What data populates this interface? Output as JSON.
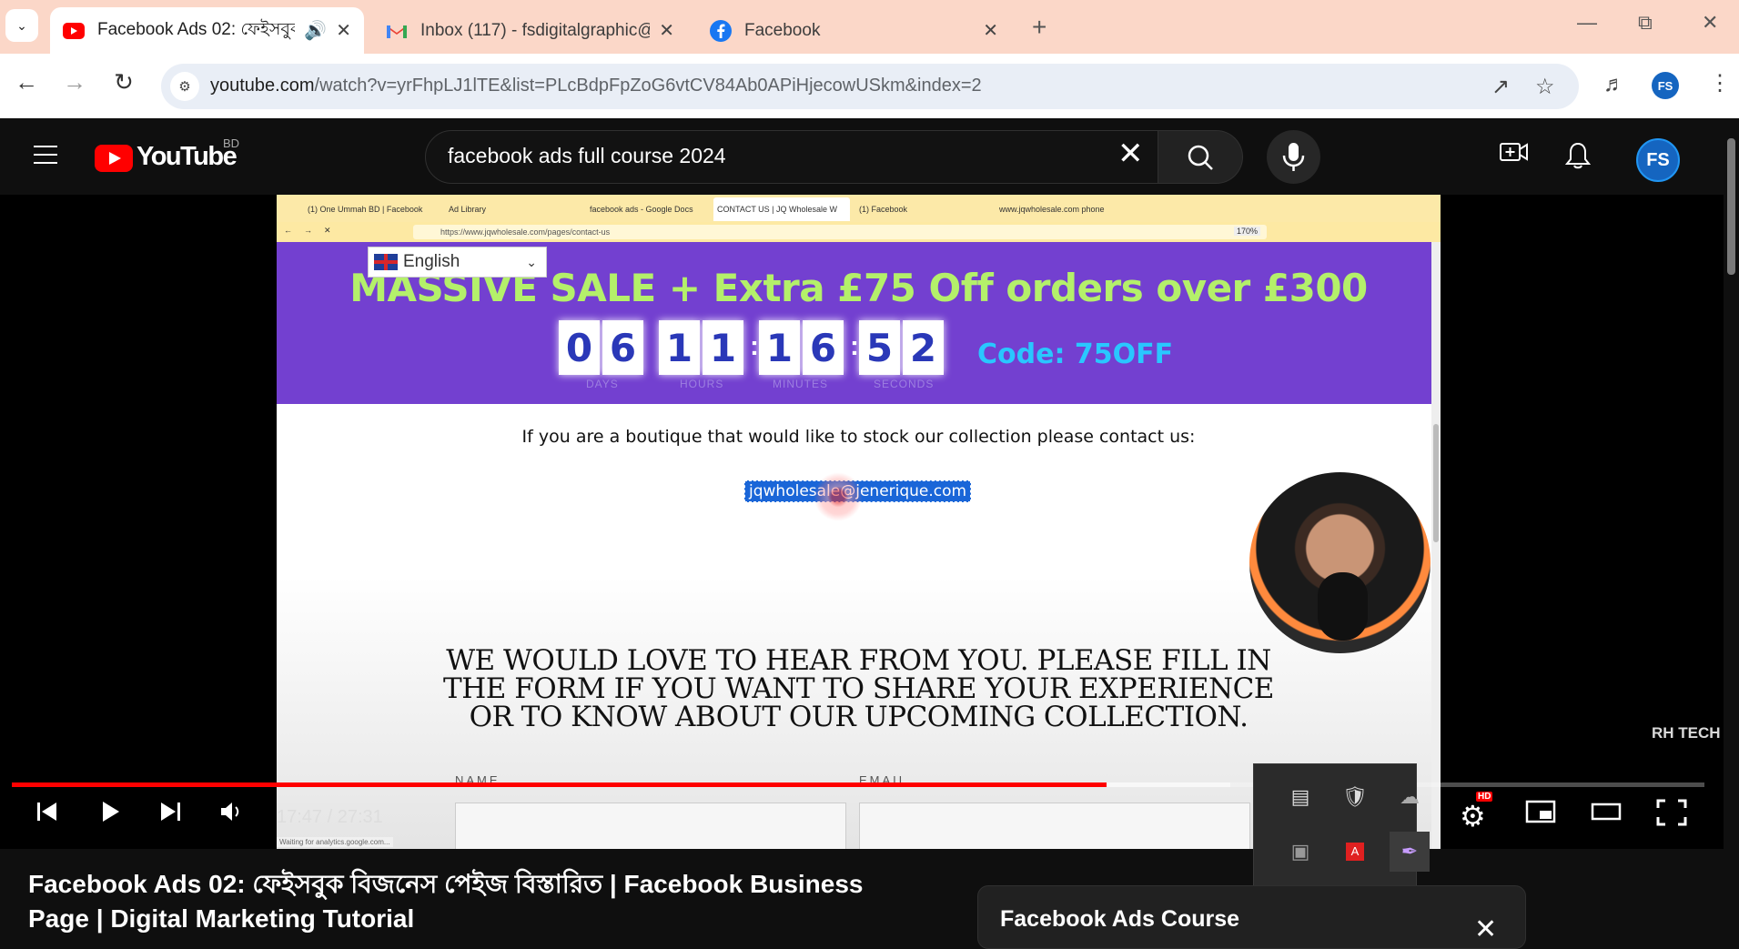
{
  "browser": {
    "tabs": [
      {
        "title": "Facebook Ads 02: ফেইসবুক",
        "icon": "youtube-icon",
        "active": true,
        "audio": true
      },
      {
        "title": "Inbox (117) - fsdigitalgraphic@g",
        "icon": "gmail-icon",
        "active": false
      },
      {
        "title": "Facebook",
        "icon": "facebook-icon",
        "active": false
      }
    ],
    "url_domain": "youtube.com",
    "url_rest": "/watch?v=yrFhpLJ1lTE&list=PLcBdpFpZoG6vtCV84Ab0APiHjecowUSkm&index=2",
    "profile_initials": "FS"
  },
  "youtube": {
    "logo_text": "YouTube",
    "country": "BD",
    "search_query": "facebook ads full course 2024",
    "avatar_initials": "FS"
  },
  "video": {
    "inner_tabs": [
      "(1) One Ummah BD | Facebook",
      "Ad Library",
      "facebook ads - Google Docs",
      "CONTACT US | JQ Wholesale W",
      "(1) Facebook",
      "www.jqwholesale.com phone"
    ],
    "inner_url": "https://www.jqwholesale.com/pages/contact-us",
    "inner_zoom": "170%",
    "language": "English",
    "banner_title": "MASSIVE SALE + Extra £75 Off orders over £300",
    "countdown": {
      "days": [
        "0",
        "6"
      ],
      "hours": [
        "1",
        "1"
      ],
      "minutes": [
        "1",
        "6"
      ],
      "seconds": [
        "5",
        "2"
      ],
      "labels": {
        "days": "DAYS",
        "hours": "HOURS",
        "minutes": "MINUTES",
        "seconds": "SECONDS"
      }
    },
    "code": "Code: 75OFF",
    "boutique_text": "If you are a boutique that would like to stock our collection please contact us:",
    "email": "jqwholesale@jenerique.com",
    "heading_lines": [
      "WE WOULD LOVE TO HEAR FROM YOU. PLEASE FILL IN",
      "THE FORM IF YOU WANT TO SHARE YOUR EXPERIENCE",
      "OR TO KNOW ABOUT OUR UPCOMING COLLECTION."
    ],
    "form_labels": {
      "name": "NAME",
      "email": "EMAIL"
    },
    "status_text": "Waiting for analytics.google.com...",
    "watermark": "RH TECH",
    "time": "17:47 / 27:31",
    "progress_played": 0.647,
    "progress_loaded": 0.72,
    "hd_badge": "HD",
    "title": "Facebook Ads 02: ফেইসবুক বিজনেস পেইজ বিস্তারিত | Facebook Business Page | Digital Marketing Tutorial",
    "playlist_title": "Facebook Ads Course"
  },
  "colors": {
    "youtube_red": "#ff0000",
    "banner_purple": "#7340d0",
    "banner_green": "#b4f06a",
    "code_cyan": "#29c7ff",
    "tabstrip": "#fbd7c8"
  }
}
